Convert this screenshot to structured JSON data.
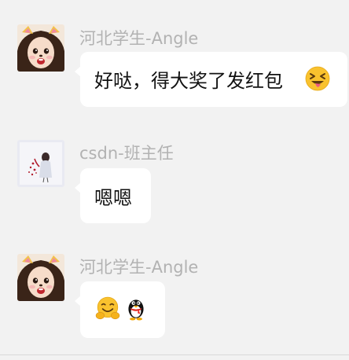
{
  "messages": [
    {
      "sender": "河北学生-Angle",
      "text": "好哒，得大奖了发红包",
      "emoji": "squinting-tongue-emoji"
    },
    {
      "sender": "csdn-班主任",
      "text": "嗯嗯"
    },
    {
      "sender": "河北学生-Angle",
      "text": "",
      "emoji": [
        "hugging-face-emoji",
        "qq-penguin-emoji"
      ]
    }
  ],
  "colors": {
    "background": "#f2f2f2",
    "bubble": "#ffffff",
    "sender": "#b2b2b2",
    "text": "#111111"
  }
}
